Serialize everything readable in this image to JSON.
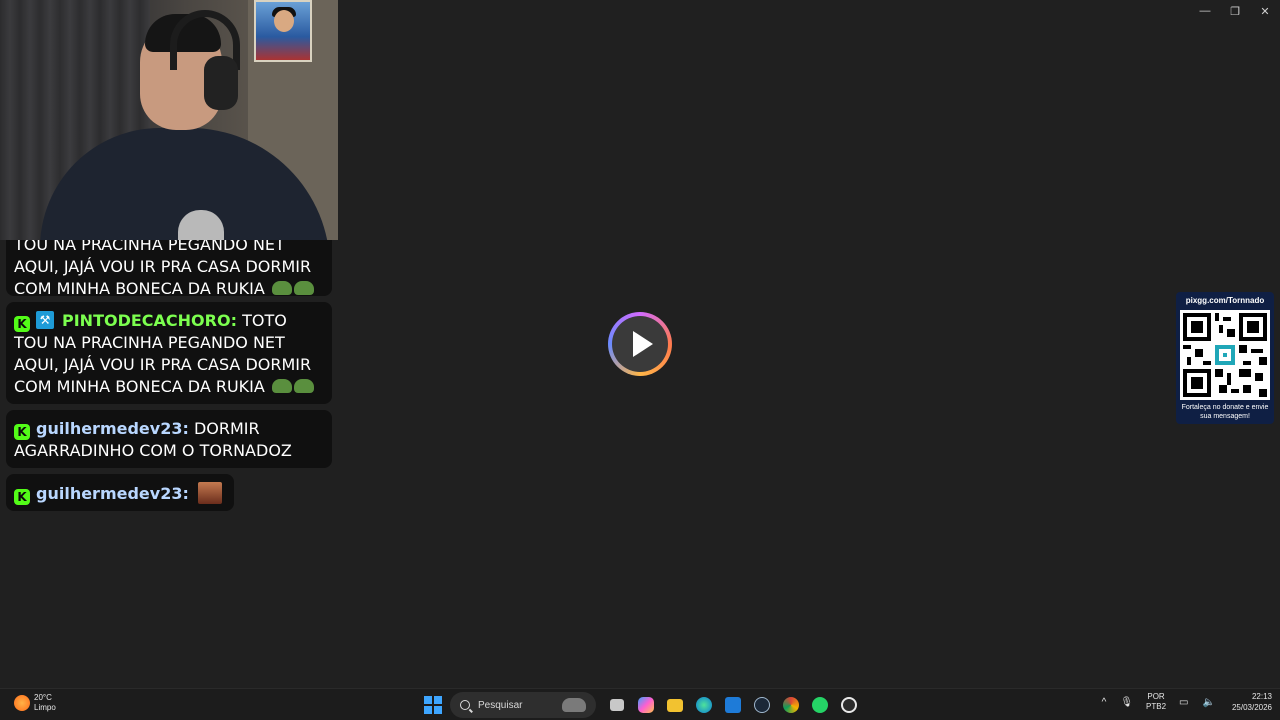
{
  "window_controls": {
    "minimize": "—",
    "restore": "❐",
    "close": "✕"
  },
  "chat": {
    "first_message": {
      "clipped_text": "TOU NA PRACINHA PEGANDO NET",
      "text": "AQUI, JAJÁ VOU IR PRA CASA DORMIR COM MINHA BONECA DA RUKIA"
    },
    "messages": [
      {
        "user": "PINTODECACHORO:",
        "text": "TOTO TOU NA PRACINHA PEGANDO NET AQUI, JAJÁ VOU IR PRA CASA DORMIR COM MINHA BONECA DA RUKIA"
      },
      {
        "user": "guilhermedev23:",
        "text": "DORMIR AGARRADINHO COM O TORNADOZ"
      },
      {
        "user": "guilhermedev23:",
        "text": ""
      }
    ],
    "badge_letter": "K"
  },
  "qr_card": {
    "url": "pixgg.com/Tornnado",
    "caption": "Fortaleça no donate e envie sua mensagem!"
  },
  "taskbar": {
    "weather_temp": "20°C",
    "weather_desc": "Limpo",
    "search_placeholder": "Pesquisar",
    "lang_top": "POR",
    "lang_bottom": "PTB2",
    "time": "22:13",
    "date": "25/03/2026",
    "tray_chevron": "^"
  },
  "colors": {
    "accent_green": "#53fc18",
    "username_green": "#7cff4f",
    "username_blue": "#b9d7ff",
    "qr_bg": "#0f1f44"
  }
}
